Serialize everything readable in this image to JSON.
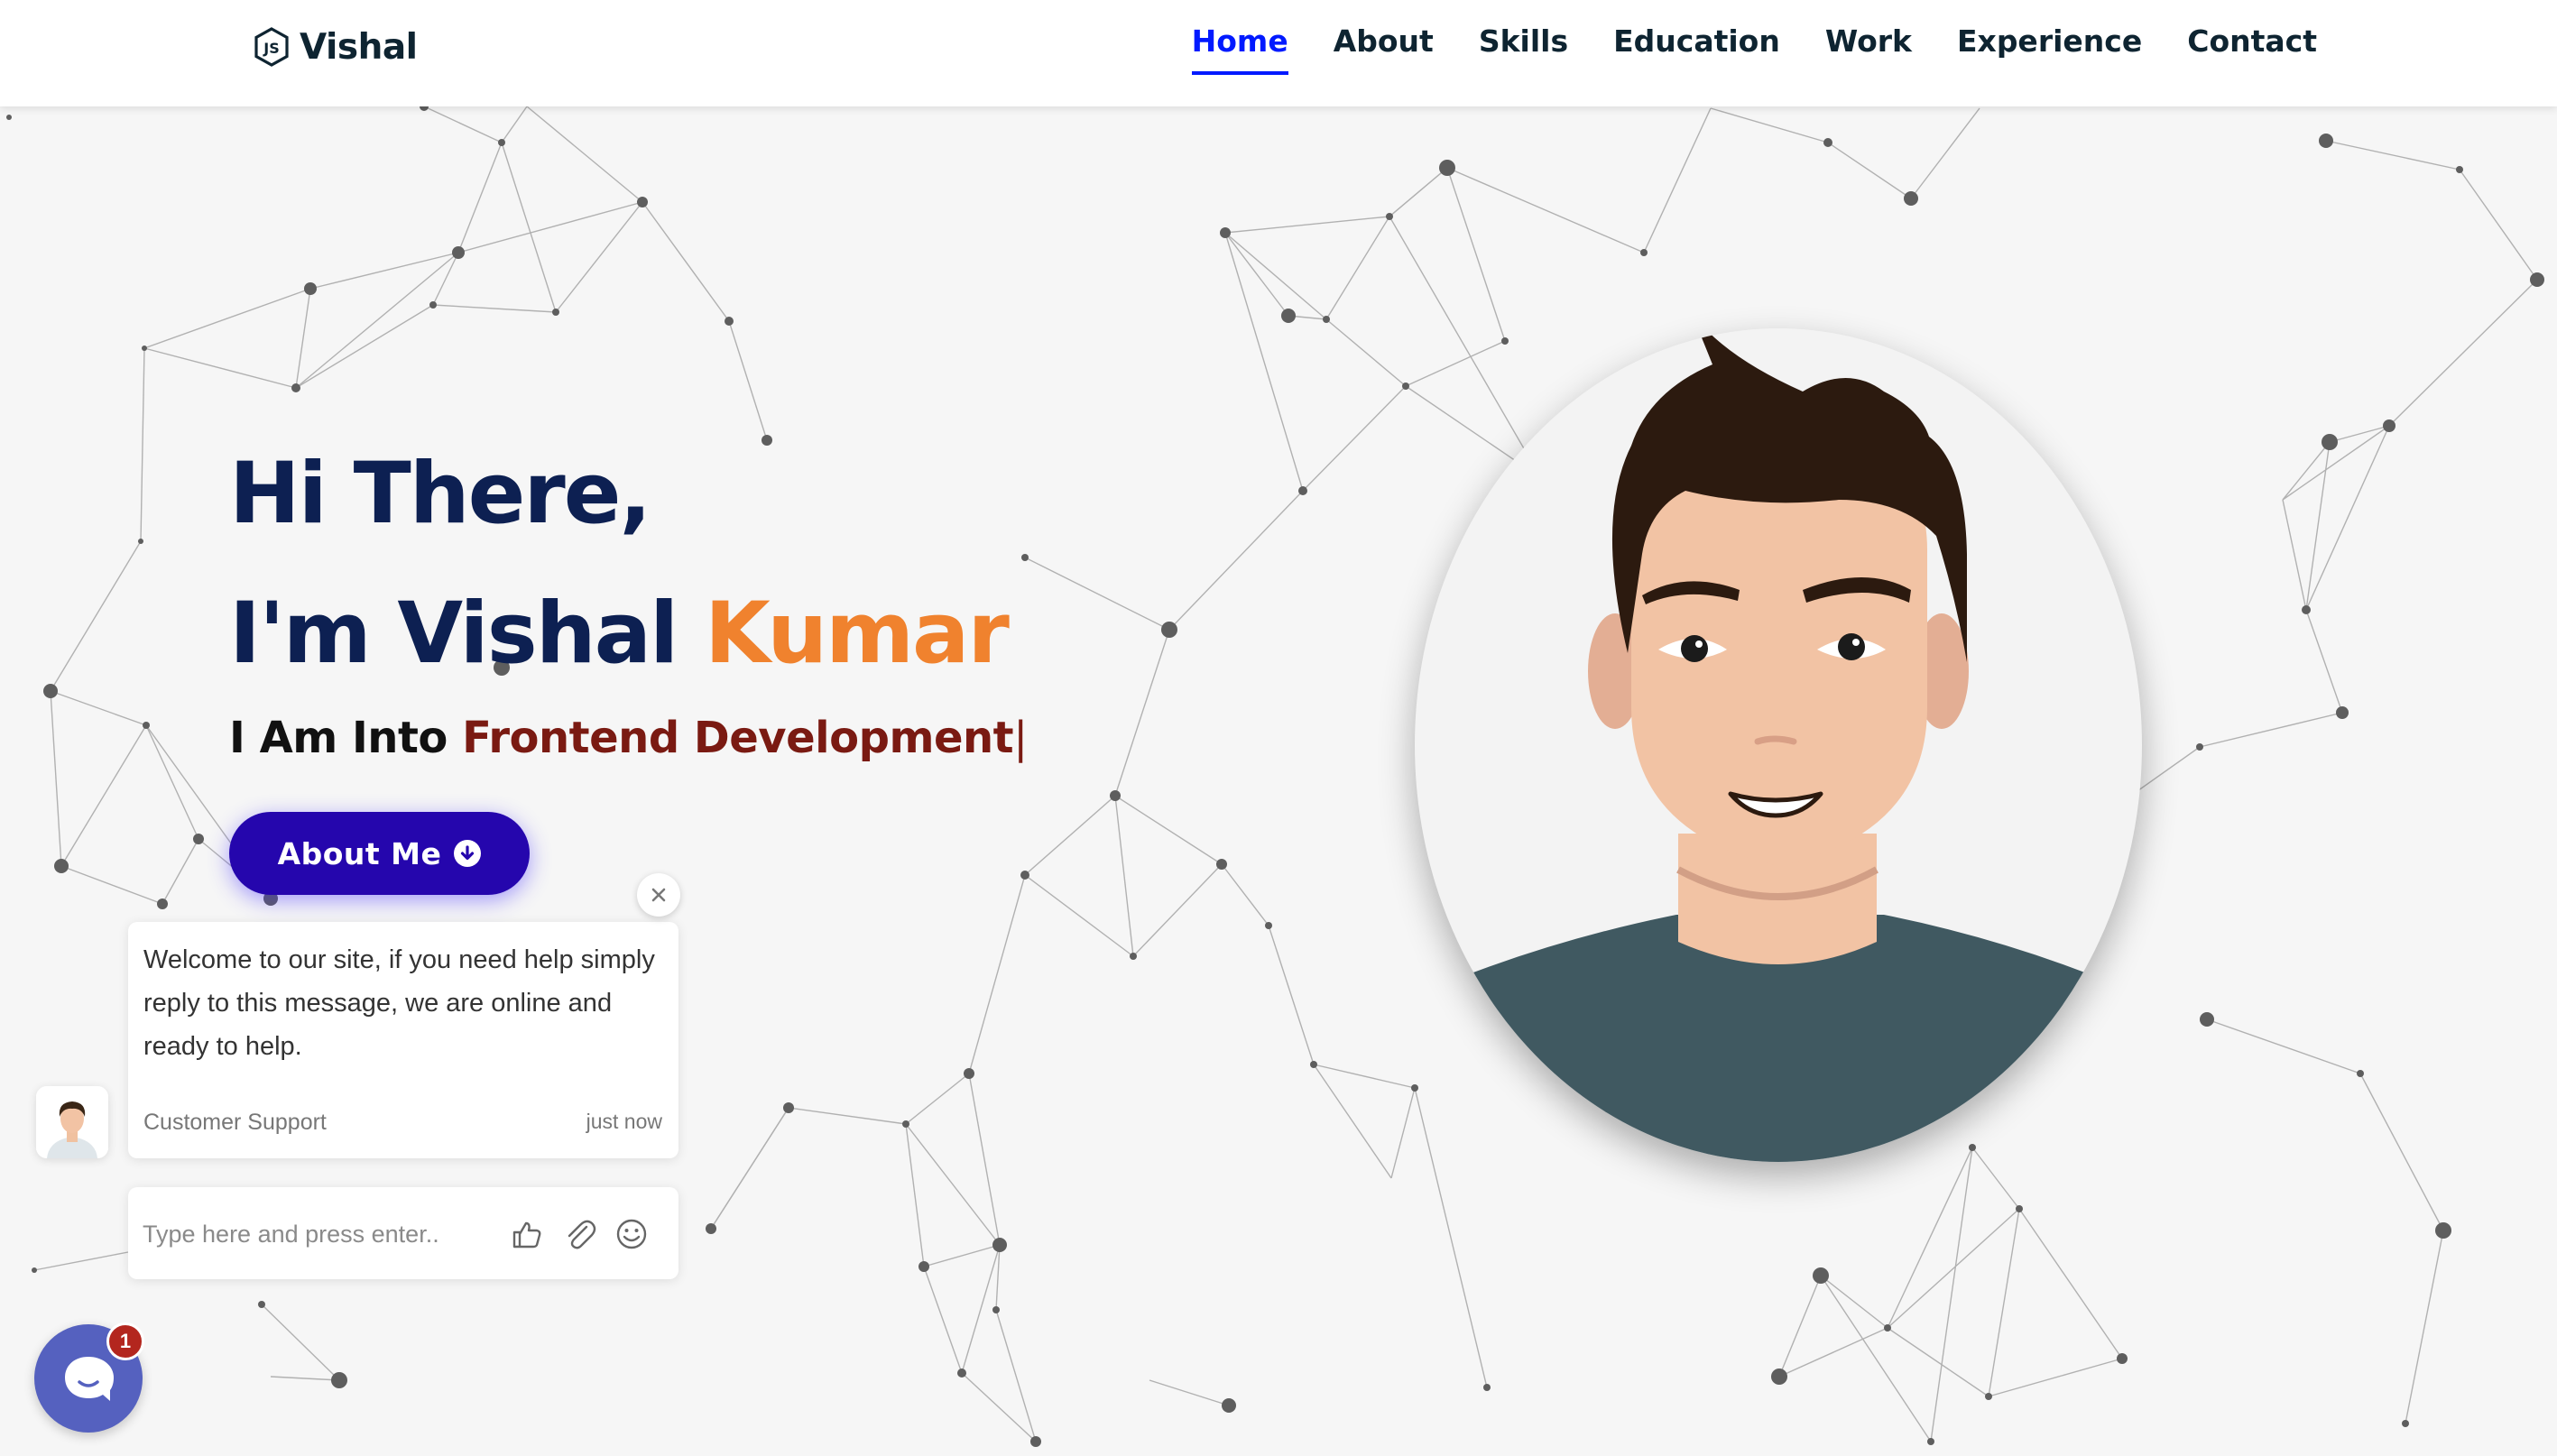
{
  "header": {
    "logo_text": "Vishal",
    "logo_icon": "js-hexagon-icon",
    "nav": [
      {
        "label": "Home",
        "active": true
      },
      {
        "label": "About",
        "active": false
      },
      {
        "label": "Skills",
        "active": false
      },
      {
        "label": "Education",
        "active": false
      },
      {
        "label": "Work",
        "active": false
      },
      {
        "label": "Experience",
        "active": false
      },
      {
        "label": "Contact",
        "active": false
      }
    ]
  },
  "hero": {
    "greeting": "Hi There,",
    "intro_prefix": "I'm Vishal",
    "intro_accent": "Kumar",
    "tagline_prefix": "I Am Into",
    "tagline_typed": "Frontend Development",
    "tagline_cursor": "|",
    "cta_label": "About Me",
    "cta_icon": "arrow-down-circle-icon"
  },
  "chat": {
    "message": "Welcome to our site, if you need help simply reply to this message, we are online and ready to help.",
    "sender": "Customer Support",
    "time": "just now",
    "input_placeholder": "Type here and press enter..",
    "unread_count": "1",
    "icons": [
      "thumbs-up-icon",
      "paperclip-icon",
      "smiley-icon",
      "close-icon",
      "chat-bubble-icon"
    ]
  },
  "colors": {
    "nav_active": "#011aff",
    "heading": "#0d2052",
    "accent_orange": "#f0822e",
    "typed_text": "#7a1a12",
    "cta_bg": "#2506ad",
    "launcher_bg": "#5561bf",
    "badge_bg": "#b3261e"
  }
}
